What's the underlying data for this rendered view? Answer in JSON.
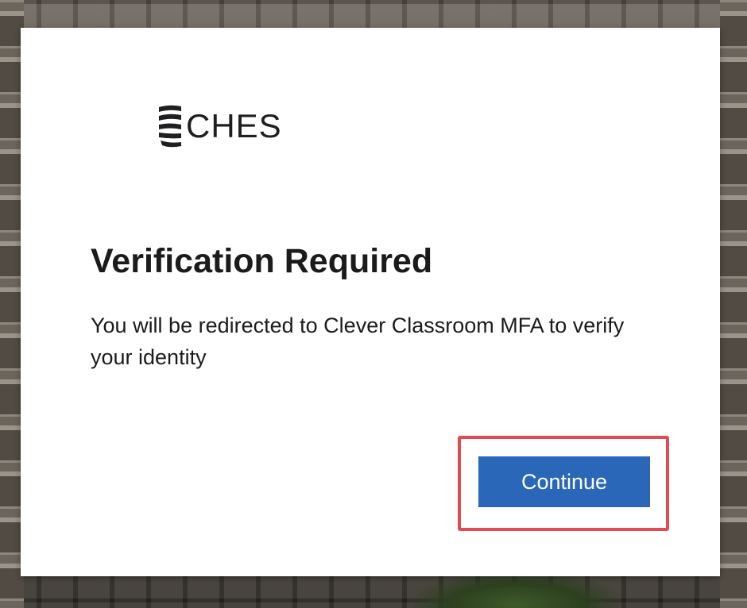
{
  "brand": {
    "logo_text": "CHES",
    "logo_mark_icon": "stacked-stripes-logo-icon"
  },
  "dialog": {
    "title": "Verification Required",
    "message": "You will be redirected to Clever Classroom MFA to verify your identity",
    "continue_label": "Continue"
  },
  "colors": {
    "button_bg": "#2a67b8",
    "highlight_border": "#e34b53",
    "text": "#1b1b1b"
  }
}
